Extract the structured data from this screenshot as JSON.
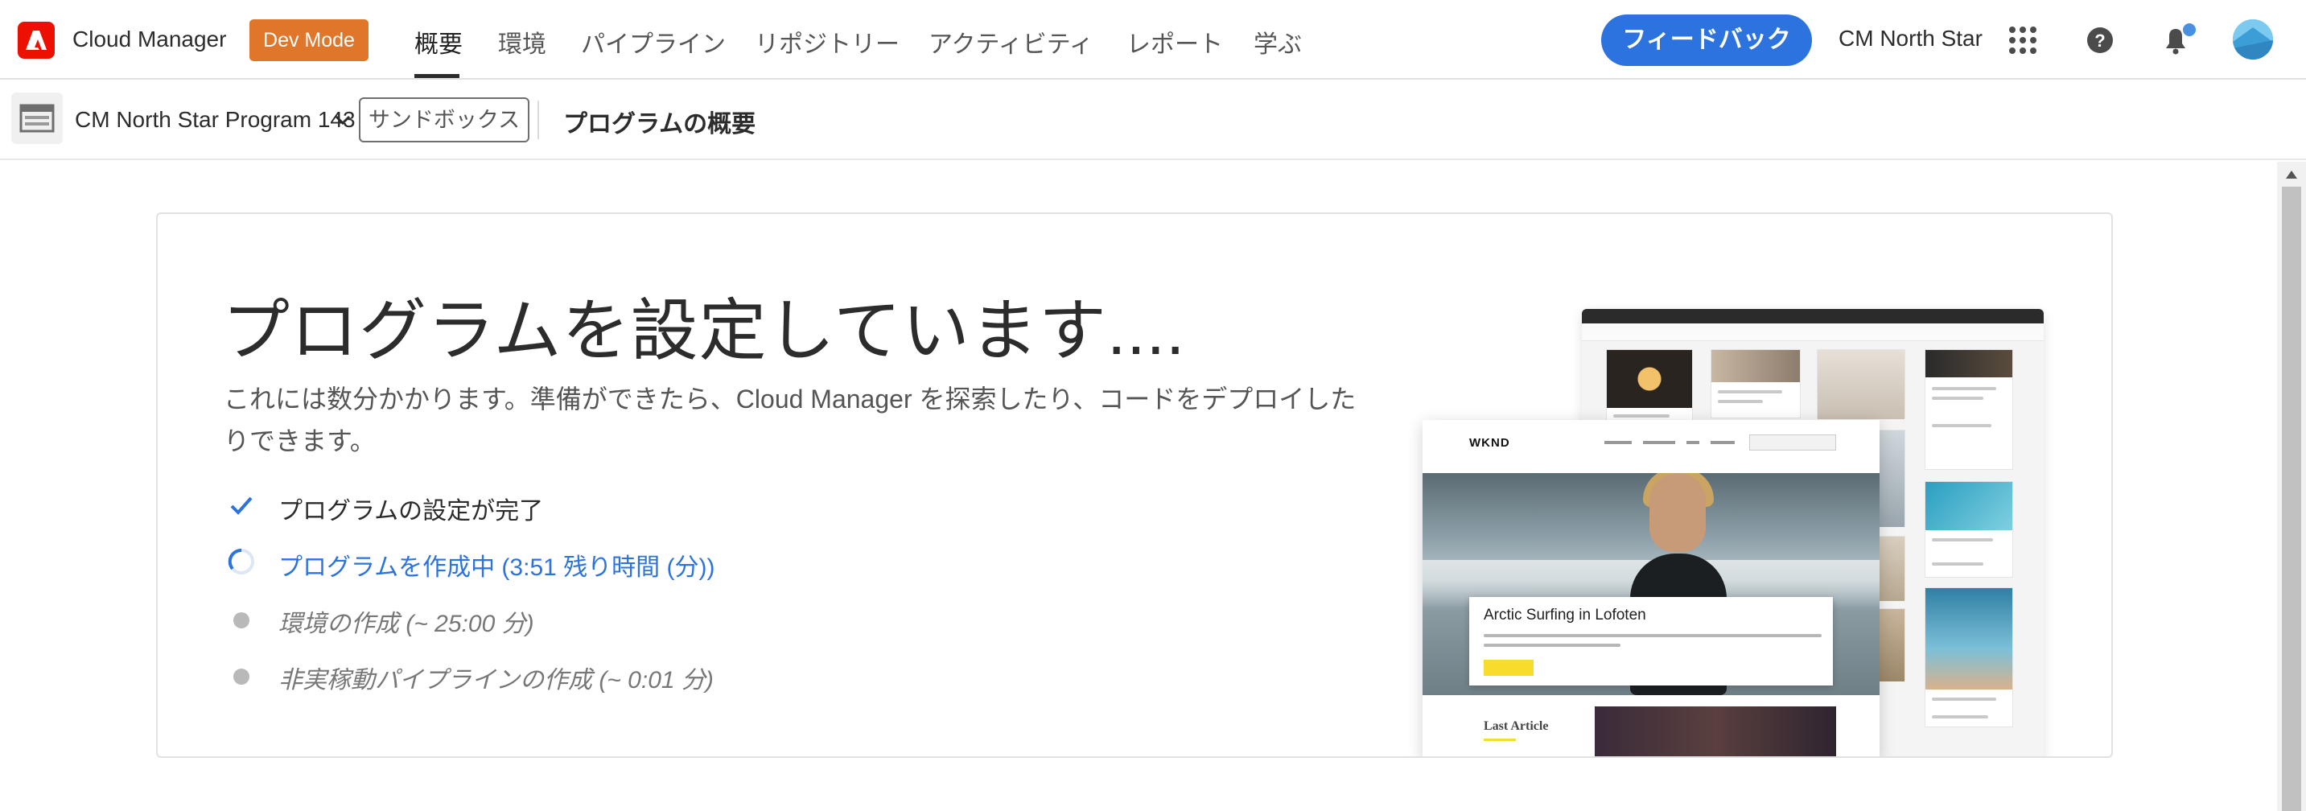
{
  "header": {
    "app_title": "Cloud Manager",
    "dev_mode_label": "Dev Mode",
    "nav": [
      {
        "label": "概要",
        "active": true
      },
      {
        "label": "環境",
        "active": false
      },
      {
        "label": "パイプライン",
        "active": false
      },
      {
        "label": "リポジトリー",
        "active": false
      },
      {
        "label": "アクティビティ",
        "active": false
      },
      {
        "label": "レポート",
        "active": false
      },
      {
        "label": "学ぶ",
        "active": false
      }
    ],
    "feedback_label": "フィードバック",
    "org_name": "CM North Star",
    "icons": [
      "apps-grid-icon",
      "help-icon",
      "notifications-icon",
      "user-avatar"
    ],
    "colors": {
      "accent": "#2c73e0",
      "dev_mode": "#e0762a",
      "brand": "#eb1000"
    }
  },
  "subheader": {
    "program_name": "CM North Star Program 143",
    "sandbox_label": "サンドボックス",
    "page_title": "プログラムの概要"
  },
  "main": {
    "heading": "プログラムを設定しています....",
    "description": "これには数分かかります。準備ができたら、Cloud Manager を探索したり、コードをデプロイしたりできます。",
    "steps": [
      {
        "label": "プログラムの設定が完了",
        "status": "done"
      },
      {
        "label": "プログラムを作成中 (3:51 残り時間 (分))",
        "status": "in-progress"
      },
      {
        "label": "環境の作成 (~ 25:00 分)",
        "status": "pending"
      },
      {
        "label": "非実稼動パイプラインの作成 (~ 0:01 分)",
        "status": "pending"
      }
    ]
  },
  "illustration": {
    "site_logo": "WKND",
    "hero_title": "Arctic Surfing in Lofoten",
    "section_title": "Last Article"
  }
}
